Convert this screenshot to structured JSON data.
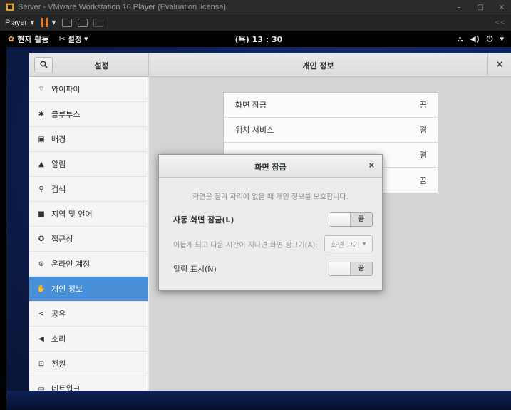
{
  "vm_window": {
    "title": "Server - VMware Workstation 16 Player (Evaluation license)",
    "minimize": "–",
    "maximize": "□",
    "close": "×"
  },
  "vm_toolbar": {
    "player_label": "Player",
    "dropdown_arrow": "▼",
    "right_icon": "<<"
  },
  "gnome_bar": {
    "activities_label": "현재 활동",
    "app_menu_label": "설정",
    "app_menu_arrow": "▾",
    "clock": "(목) 13 : 30",
    "network_icon": "⛬",
    "volume_icon": "◀)",
    "power_icon": "⏻",
    "power_arrow": "▾"
  },
  "settings": {
    "sidebar_title": "설정",
    "main_title": "개인 정보",
    "close_label": "×",
    "search_icon": "🔍"
  },
  "sidebar": {
    "items": [
      {
        "icon": "wifi-icon",
        "glyph": "⌔",
        "label": "와이파이"
      },
      {
        "icon": "bluetooth-icon",
        "glyph": "✱",
        "label": "블루투스"
      },
      {
        "icon": "background-icon",
        "glyph": "▣",
        "label": "배경"
      },
      {
        "icon": "notifications-icon",
        "glyph": "▲",
        "label": "알림"
      },
      {
        "icon": "search-icon",
        "glyph": "⚲",
        "label": "검색"
      },
      {
        "icon": "region-language-icon",
        "glyph": "■",
        "label": "지역 및 언어"
      },
      {
        "icon": "accessibility-icon",
        "glyph": "✪",
        "label": "접근성"
      },
      {
        "icon": "online-accounts-icon",
        "glyph": "⊛",
        "label": "온라인 계정"
      },
      {
        "icon": "privacy-icon",
        "glyph": "✋",
        "label": "개인 정보"
      },
      {
        "icon": "share-icon",
        "glyph": "<",
        "label": "공유"
      },
      {
        "icon": "sound-icon",
        "glyph": "◀",
        "label": "소리"
      },
      {
        "icon": "power-icon",
        "glyph": "⊡",
        "label": "전원"
      },
      {
        "icon": "network-icon",
        "glyph": "▭",
        "label": "네트워크"
      }
    ],
    "active_index": 8
  },
  "privacy": {
    "rows": [
      {
        "label": "화면 잠금",
        "value": "끔"
      },
      {
        "label": "위치 서비스",
        "value": "켬"
      },
      {
        "label": "",
        "value": "켬"
      },
      {
        "label": "",
        "value": "끔"
      }
    ]
  },
  "dialog": {
    "title": "화면 잠금",
    "close_label": "×",
    "description": "화면은 잠겨 자리에 없을 때 개인 정보를 보호합니다.",
    "auto_lock_label": "자동 화면 잠금(L)",
    "auto_lock_state": "끔",
    "delay_label": "어둡게 되고 다음 시간이 지나면 화면 잠그기(A):",
    "delay_value": "화면 끄기",
    "delay_arrow": "▾",
    "show_notifications_label": "알림 표시(N)",
    "show_notifications_state": "끔"
  }
}
